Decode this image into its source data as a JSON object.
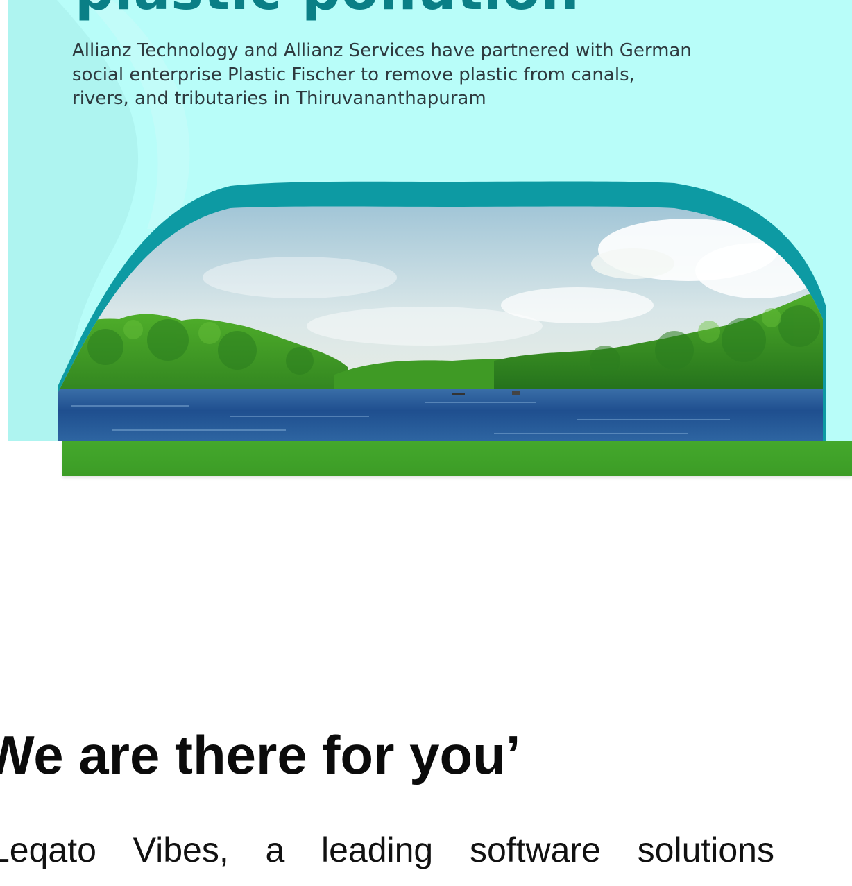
{
  "banner": {
    "heading": "plastic pollution",
    "subtext": "Allianz Technology and Allianz Services have partnered with German social enterprise Plastic Fischer to remove plastic from canals, rivers, and tributaries in Thiruvananthapuram",
    "colors": {
      "background": "#b8fdf9",
      "teal": "#0a7f86",
      "green": "#44a82c"
    },
    "image": "river-mangrove-photo"
  },
  "article": {
    "heading": "We are there for you’",
    "body": "Leqato Vibes, a leading software solutions"
  }
}
